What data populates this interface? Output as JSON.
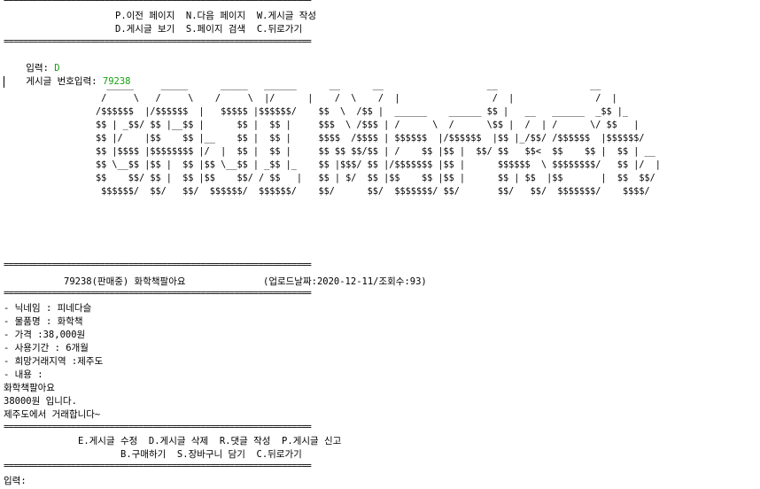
{
  "rule": "================================================================",
  "menu_top": {
    "row1": "P.이전 페이지  N.다음 페이지  W.게시글 작성",
    "row2": "D.게시글 보기  S.페이지 검색  C.뒤로가기"
  },
  "input1": {
    "label": "입력: ",
    "value": "D"
  },
  "input2": {
    "label": "게시글 번호입력: ",
    "value": "79238"
  },
  "banner": "  _____     _____      _____   ______      __      __                   __                 __\n /     \\   /     \\    /     \\  |/      |    /  \\    /  |                 /  |               /  |\n/$$$$$$  |/$$$$$$  |   $$$$$ |$$$$$$/    $$  \\  /$$ |  ______    ______ $$ |   __   ______  _$$ |_\n$$ | _$$/ $$ |__$$ |      $$ |  $$ |     $$$  \\ /$$$ | /      \\  /      \\$$ |  /  | /      \\/ $$   |\n$$ |/    |$$    $$ |__    $$ |  $$ |     $$$$  /$$$$ | $$$$$$  |/$$$$$$  |$$ |_/$$/ /$$$$$$  |$$$$$$/\n$$ |$$$$ |$$$$$$$$ |/  |  $$ |  $$ |     $$ $$ $$/$$ | /    $$ |$$ |  $$/ $$   $$<  $$    $$ |  $$ | __\n$$ \\__$$ |$$ |  $$ |$$ \\__$$ | _$$ |_    $$ |$$$/ $$ |/$$$$$$$ |$$ |      $$$$$$  \\ $$$$$$$$/   $$ |/  |\n$$    $$/ $$ |  $$ |$$    $$/ / $$   |   $$ | $/  $$ |$$    $$ |$$ |      $$ | $$  |$$       |  $$  $$/\n $$$$$$/  $$/   $$/  $$$$$$/  $$$$$$/    $$/      $$/  $$$$$$$/ $$/       $$/   $$/  $$$$$$$/    $$$$/",
  "post_header": {
    "title": "79238(판매중) 화학책팔아요",
    "meta": "(업로드날짜:2020-12-11/조회수:93)"
  },
  "details": [
    "- 닉네임 : 피네다슬",
    "- 물품명 : 화학책",
    "- 가격 :38,000원",
    "- 사용기간 : 6개월",
    "- 희망거래지역 :제주도",
    "- 내용 :"
  ],
  "content": [
    "화학책팔아요",
    "38000원 입니다.",
    "제주도에서 거래합니다~"
  ],
  "menu_bottom": {
    "row1": "E.게시글 수정  D.게시글 삭제  R.댓글 작성  P.게시글 신고",
    "row2": "B.구매하기  S.장바구니 담기  C.뒤로가기"
  },
  "input3": {
    "label": "입력:"
  },
  "colors": {
    "input_value": "#13a10e",
    "text": "#000000",
    "background": "#ffffff"
  }
}
